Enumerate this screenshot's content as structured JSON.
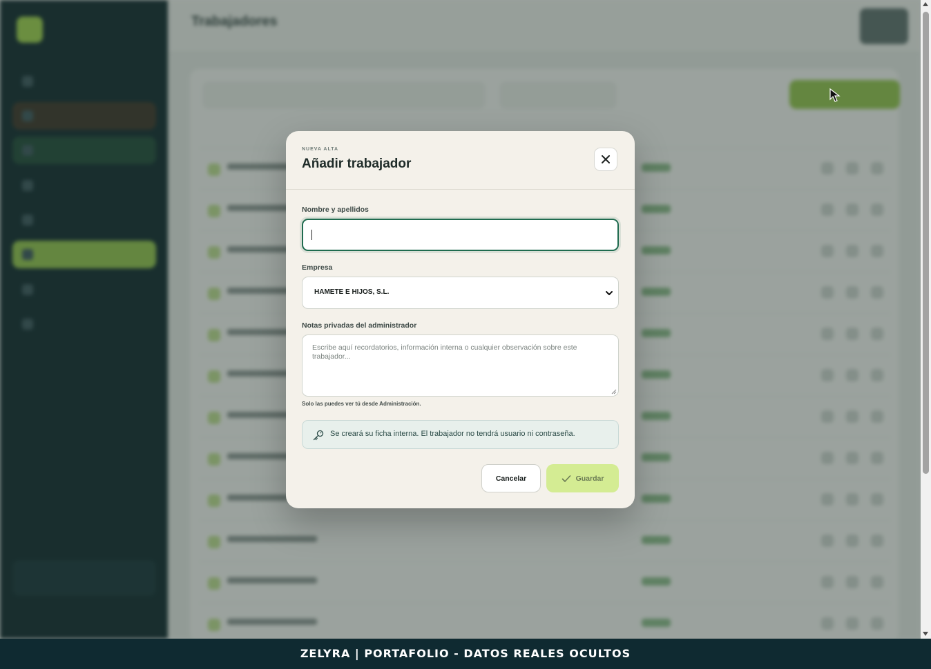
{
  "modal": {
    "eyebrow": "NUEVA ALTA",
    "title": "Añadir trabajador",
    "name_label": "Nombre y apellidos",
    "name_value": "",
    "company_label": "Empresa",
    "company_selected": "HAMETE E HIJOS, S.L.",
    "notes_label": "Notas privadas del administrador",
    "notes_placeholder": "Escribe aquí recordatorios, información interna o cualquier observación sobre este trabajador...",
    "notes_hint": "Solo las puedes ver tú desde Administración.",
    "info_text": "Se creará su ficha interna. El trabajador no tendrá usuario ni contraseña.",
    "cancel_label": "Cancelar",
    "save_label": "Guardar"
  },
  "background": {
    "page_title": "Trabajadores"
  },
  "banner": {
    "text": "ZELYRA | PORTAFOLIO - DATOS REALES OCULTOS"
  },
  "colors": {
    "sidebar": "#0e2a2c",
    "accent_green": "#8fc24a",
    "focus_border": "#1f6b4f",
    "save_button": "#d4ec93",
    "banner": "#0f2a31"
  },
  "icons": {
    "close": "close-icon",
    "select_arrow": "chevron-down-icon",
    "info": "key-icon",
    "save": "check-icon"
  }
}
